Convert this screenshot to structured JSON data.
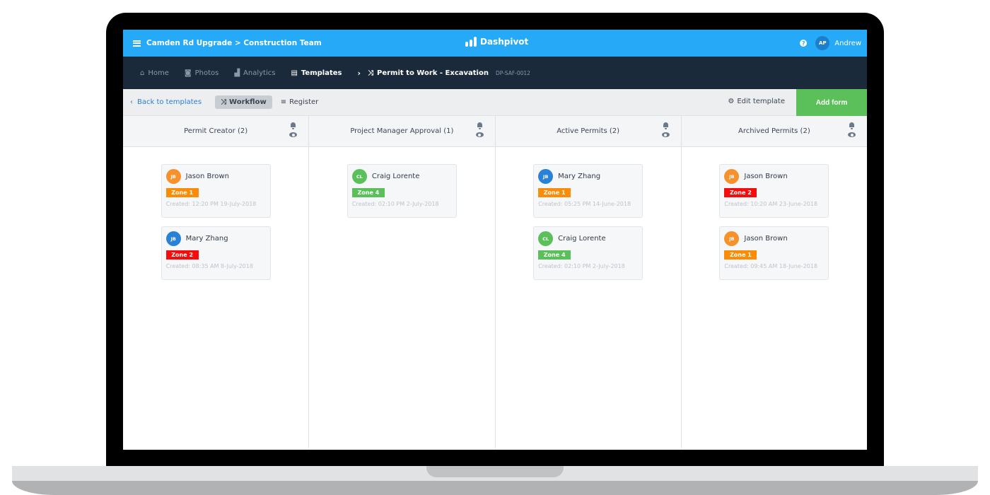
{
  "topbar": {
    "project_path": "Camden Rd Upgrade > Construction Team",
    "brand": "Dashpivot",
    "user_initials": "AP",
    "user_name": "Andrew",
    "color": "#26aaf7"
  },
  "nav": {
    "items": [
      {
        "label": "Home",
        "icon": "home-icon"
      },
      {
        "label": "Photos",
        "icon": "camera-icon"
      },
      {
        "label": "Analytics",
        "icon": "area-chart-icon"
      },
      {
        "label": "Templates",
        "icon": "file-icon",
        "active": true
      }
    ],
    "current": "Permit to Work - Excavation",
    "current_code": "DP-SAF-0012"
  },
  "toolbar": {
    "back_label": "Back to templates",
    "workflow_label": "Workflow",
    "register_label": "Register",
    "edit_label": "Edit template",
    "add_label": "Add form"
  },
  "columns": [
    {
      "title": "Permit Creator (2)",
      "cards": [
        {
          "initials": "JB",
          "name": "Jason Brown",
          "avatar_color": "#f7912c",
          "zone": "Zone 1",
          "zone_color": "#fa8c07",
          "created": "Created: 12:20 PM 19-July-2018"
        },
        {
          "initials": "JB",
          "name": "Mary Zhang",
          "avatar_color": "#2a82d6",
          "zone": "Zone 2",
          "zone_color": "#f30d0d",
          "created": "Created: 08:35 AM 8-July-2018"
        }
      ]
    },
    {
      "title": "Project Manager Approval (1)",
      "cards": [
        {
          "initials": "CL",
          "name": "Craig Lorente",
          "avatar_color": "#5bc05a",
          "zone": "Zone 4",
          "zone_color": "#5bc05a",
          "created": "Created: 02:10 PM 2-July-2018"
        }
      ]
    },
    {
      "title": "Active Permits (2)",
      "cards": [
        {
          "initials": "JB",
          "name": "Mary Zhang",
          "avatar_color": "#2a82d6",
          "zone": "Zone 1",
          "zone_color": "#fa8c07",
          "created": "Created: 05:25 PM 14-June-2018"
        },
        {
          "initials": "CL",
          "name": "Craig Lorente",
          "avatar_color": "#5bc05a",
          "zone": "Zone 4",
          "zone_color": "#5bc05a",
          "created": "Created: 02:10 PM 2-July-2018"
        }
      ]
    },
    {
      "title": "Archived Permits (2)",
      "cards": [
        {
          "initials": "JB",
          "name": "Jason Brown",
          "avatar_color": "#f7912c",
          "zone": "Zone 2",
          "zone_color": "#f30d0d",
          "created": "Created: 10:20 AM 23-June-2018"
        },
        {
          "initials": "JB",
          "name": "Jason Brown",
          "avatar_color": "#f7912c",
          "zone": "Zone 1",
          "zone_color": "#fa8c07",
          "created": "Created: 09:45 AM 18-June-2018"
        }
      ]
    }
  ]
}
